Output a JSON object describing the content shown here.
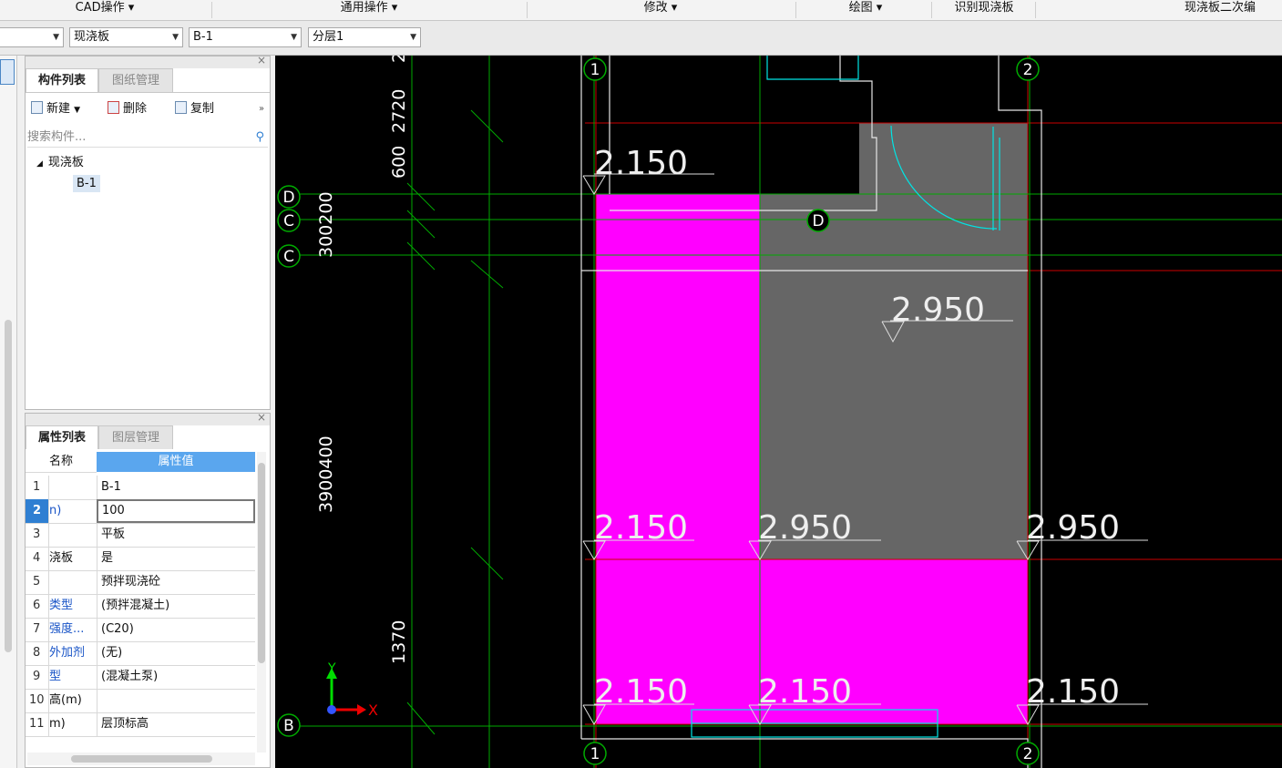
{
  "menubar": {
    "items": [
      {
        "label": "CAD操作"
      },
      {
        "label": "通用操作"
      },
      {
        "label": "修改"
      },
      {
        "label": "绘图"
      },
      {
        "label": "识别现浇板"
      },
      {
        "label": "现浇板二次编"
      }
    ]
  },
  "toolbar": {
    "combo_type": "现浇板",
    "combo_component": "B-1",
    "combo_layer": "分层1"
  },
  "component_panel": {
    "tab_components": "构件列表",
    "tab_drawings": "图纸管理",
    "btn_new": "新建",
    "btn_delete": "删除",
    "btn_copy": "复制",
    "search_placeholder": "搜索构件...",
    "tree_root": "现浇板",
    "tree_child": "B-1"
  },
  "property_panel": {
    "tab_properties": "属性列表",
    "tab_layers": "图层管理",
    "col_name": "名称",
    "col_value": "属性值",
    "rows": [
      {
        "num": "1",
        "name": "",
        "value": "B-1"
      },
      {
        "num": "2",
        "name": "n)",
        "value": "100"
      },
      {
        "num": "3",
        "name": "",
        "value": "平板"
      },
      {
        "num": "4",
        "name": "浇板",
        "value": "是"
      },
      {
        "num": "5",
        "name": "",
        "value": "预拌现浇砼"
      },
      {
        "num": "6",
        "name": "类型",
        "value": "(预拌混凝土)"
      },
      {
        "num": "7",
        "name": "强度...",
        "value": "(C20)"
      },
      {
        "num": "8",
        "name": "外加剂",
        "value": "(无)"
      },
      {
        "num": "9",
        "name": "型",
        "value": "(混凝土泵)"
      },
      {
        "num": "10",
        "name": "高(m)",
        "value": ""
      },
      {
        "num": "11",
        "name": "m)",
        "value": "层顶标高"
      }
    ]
  },
  "canvas": {
    "grid_top_1": "1",
    "grid_top_2": "2",
    "grid_bottom_1": "1",
    "grid_bottom_2": "2",
    "grid_left_D": "D",
    "grid_left_C1": "C",
    "grid_left_C2": "C",
    "grid_left_B": "B",
    "grid_mid_D": "D",
    "dim_2": "2",
    "dim_2720": "2720",
    "dim_600": "600",
    "dim_300_200": "300200",
    "dim_3900_400": "3900400",
    "dim_1370": "1370",
    "elev_top": "2.150",
    "elev_mid_gray": "2.950",
    "elev_row2_a": "2.150",
    "elev_row2_b": "2.950",
    "elev_row2_c": "2.950",
    "elev_row3_a": "2.150",
    "elev_row3_b": "2.150",
    "elev_row3_c": "2.150",
    "axis_x": "X",
    "axis_y": "Y",
    "colors": {
      "slab_magenta": "#ff00ff",
      "slab_gray": "#666666",
      "axis_red": "#cc0000",
      "axis_green": "#00aa00",
      "wall_white": "#e6e6e6",
      "cyan": "#00e5e5"
    }
  }
}
